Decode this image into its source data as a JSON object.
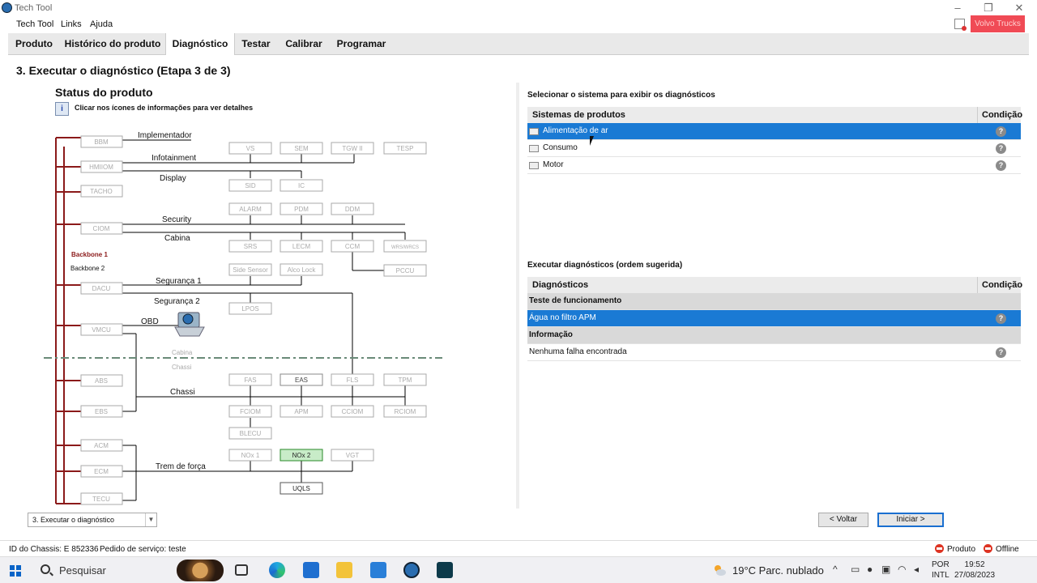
{
  "window": {
    "title": "Tech Tool",
    "brand_label": "Volvo Trucks"
  },
  "menu": [
    "Tech Tool",
    "Links",
    "Ajuda"
  ],
  "tabs": [
    {
      "label": "Produto",
      "active": false
    },
    {
      "label": "Histórico do produto",
      "active": false
    },
    {
      "label": "Diagnóstico",
      "active": true
    },
    {
      "label": "Testar",
      "active": false
    },
    {
      "label": "Calibrar",
      "active": false
    },
    {
      "label": "Programar",
      "active": false
    }
  ],
  "step_title": "3. Executar o diagnóstico (Etapa 3 de 3)",
  "status": {
    "title": "Status do produto",
    "info_text": "Clicar nos ícones de informações para ver detalhes",
    "info_icon": "info-icon"
  },
  "diagram": {
    "labels": {
      "implementador": "Implementador",
      "infotainment": "Infotainment",
      "display": "Display",
      "security": "Security",
      "cabina": "Cabina",
      "backbone1": "Backbone 1",
      "backbone2": "Backbone 2",
      "seguranca1": "Segurança 1",
      "seguranca2": "Segurança 2",
      "obd": "OBD",
      "cabina_zone": "Cabina",
      "chassi_zone": "Chassi",
      "chassi": "Chassi",
      "trem": "Trem de força"
    },
    "left_nodes": [
      "BBM",
      "HMIIOM",
      "TACHO",
      "CIOM",
      "DACU",
      "VMCU",
      "ABS",
      "EBS",
      "ACM",
      "ECM",
      "TECU"
    ],
    "nodes": [
      "VS",
      "SEM",
      "TGW II",
      "TESP",
      "SID",
      "IC",
      "ALARM",
      "PDM",
      "DDM",
      "SRS",
      "LECM",
      "CCM",
      "WRS/WRCS",
      "PCCU",
      "Side Sensor",
      "Alco Lock",
      "LPOS",
      "FAS",
      "EAS",
      "FLS",
      "TPM",
      "FCIOM",
      "APM",
      "CCIOM",
      "RCIOM",
      "BLECU",
      "NOx 1",
      "NOx 2",
      "VGT",
      "UQLS"
    ],
    "highlight_node": "NOx 2",
    "colors": {
      "backbone": "#8b1a1a",
      "highlight_bg": "#c8ecc8",
      "highlight_border": "#2a8a2a",
      "zone_line": "#6a8a78"
    }
  },
  "systems": {
    "section_label": "Selecionar o sistema para exibir os diagnósticos",
    "col_systems": "Sistemas de produtos",
    "col_condition": "Condição",
    "rows": [
      {
        "label": "Alimentação de ar",
        "selected": true
      },
      {
        "label": "Consumo",
        "selected": false
      },
      {
        "label": "Motor",
        "selected": false
      }
    ]
  },
  "diagnostics": {
    "section_label": "Executar diagnósticos (ordem sugerida)",
    "col_diag": "Diagnósticos",
    "col_condition": "Condição",
    "rows": [
      {
        "label": "Teste de funcionamento",
        "type": "group"
      },
      {
        "label": "Água no filtro APM",
        "type": "selected"
      },
      {
        "label": "Informação",
        "type": "group"
      },
      {
        "label": "Nenhuma falha encontrada",
        "type": "normal"
      }
    ]
  },
  "bottom": {
    "step_select": "3. Executar o diagnóstico",
    "back": "< Voltar",
    "start": "Iniciar >"
  },
  "statusbar": {
    "chassis": "ID do Chassis: E 852336",
    "order": "Pedido de serviço: teste",
    "produto": "Produto",
    "offline": "Offline"
  },
  "taskbar": {
    "search": "Pesquisar",
    "weather": "19°C  Parc. nublado",
    "lang1": "POR",
    "lang2": "INTL",
    "time": "19:52",
    "date": "27/08/2023"
  }
}
